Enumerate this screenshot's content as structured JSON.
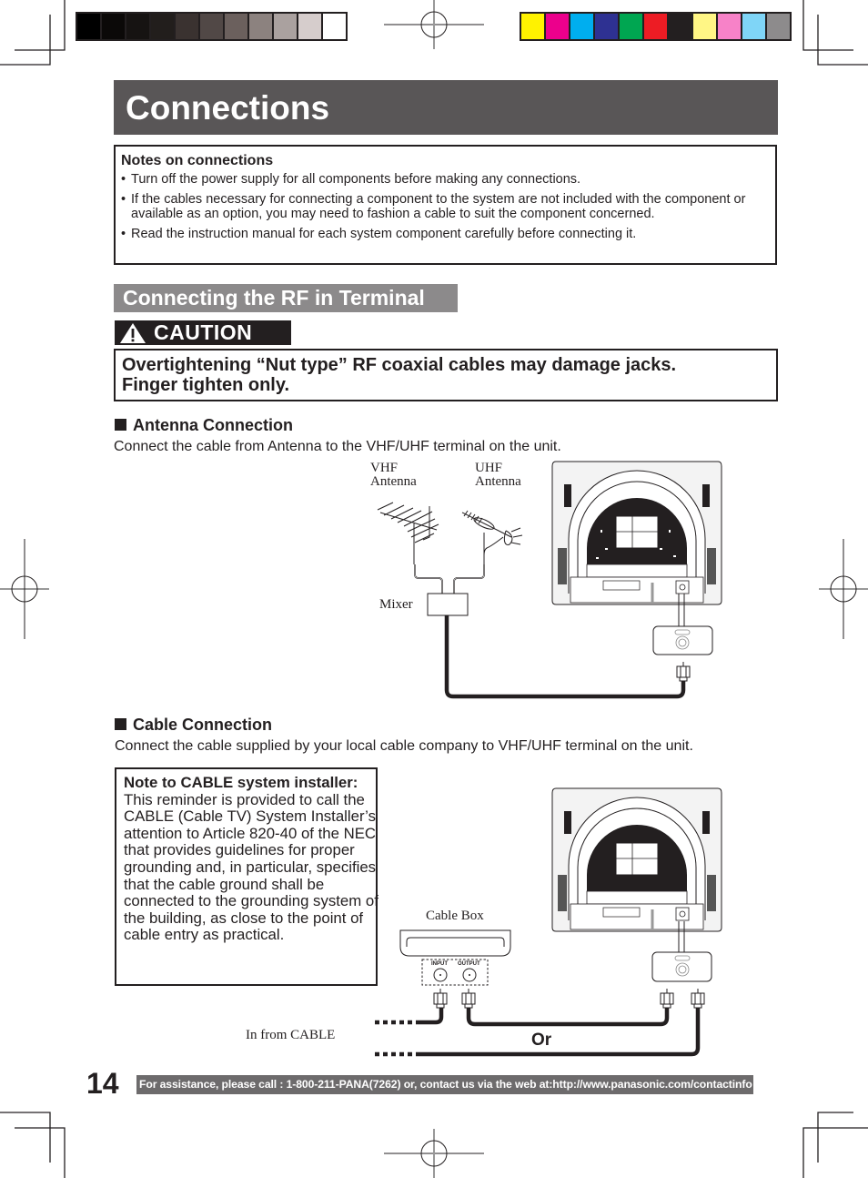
{
  "print_marks": {
    "grayscale_swatches": [
      "#000000",
      "#0b0908",
      "#161312",
      "#221e1c",
      "#3a3230",
      "#514846",
      "#6b605d",
      "#8c827f",
      "#aaa19f",
      "#d6cdcc",
      "#ffffff"
    ],
    "color_swatches": [
      "#fff200",
      "#ec008c",
      "#00aeef",
      "#2e3192",
      "#00a651",
      "#ed1c24",
      "#231f20",
      "#fff685",
      "#f782c8",
      "#7fd5f7",
      "#8d8b8c"
    ]
  },
  "page": {
    "title": "Connections",
    "page_number": "14"
  },
  "notes": {
    "title": "Notes on connections",
    "items": [
      "Turn off the power supply for all components before making any connections.",
      "If the cables necessary for connecting a component to the system are not included with the component or available as an option, you may need to fashion a cable to suit the component concerned.",
      "Read the instruction manual for each system component carefully before connecting it."
    ]
  },
  "section": {
    "title": "Connecting the RF in Terminal"
  },
  "caution": {
    "label": "CAUTION",
    "line1": "Overtightening “Nut type” RF coaxial cables may damage jacks.",
    "line2": "Finger tighten only."
  },
  "antenna": {
    "heading": "Antenna Connection",
    "description": "Connect the cable from Antenna to the VHF/UHF terminal on the unit.",
    "labels": {
      "vhf_line1": "VHF",
      "vhf_line2": "Antenna",
      "uhf_line1": "UHF",
      "uhf_line2": "Antenna",
      "mixer": "Mixer"
    }
  },
  "cable": {
    "heading": "Cable Connection",
    "description": "Connect the cable supplied by your local cable company to VHF/UHF terminal on the unit.",
    "installer_note": {
      "title": "Note to CABLE system installer:",
      "body": "This reminder is provided to call the CABLE (Cable TV) System Installer’s attention to Article 820-40 of the NEC that provides guidelines for proper grounding and, in particular, specifies that the cable ground shall be connected to the grounding system of the building, as close to the point of cable entry as practical."
    },
    "labels": {
      "cable_box": "Cable Box",
      "input": "INPUT",
      "output": "OUTPUT",
      "in_from_cable": "In from CABLE",
      "or": "Or"
    }
  },
  "footer": {
    "assistance": "For assistance, please call : 1-800-211-PANA(7262) or, contact us via the web at:http://www.panasonic.com/contactinfo"
  }
}
